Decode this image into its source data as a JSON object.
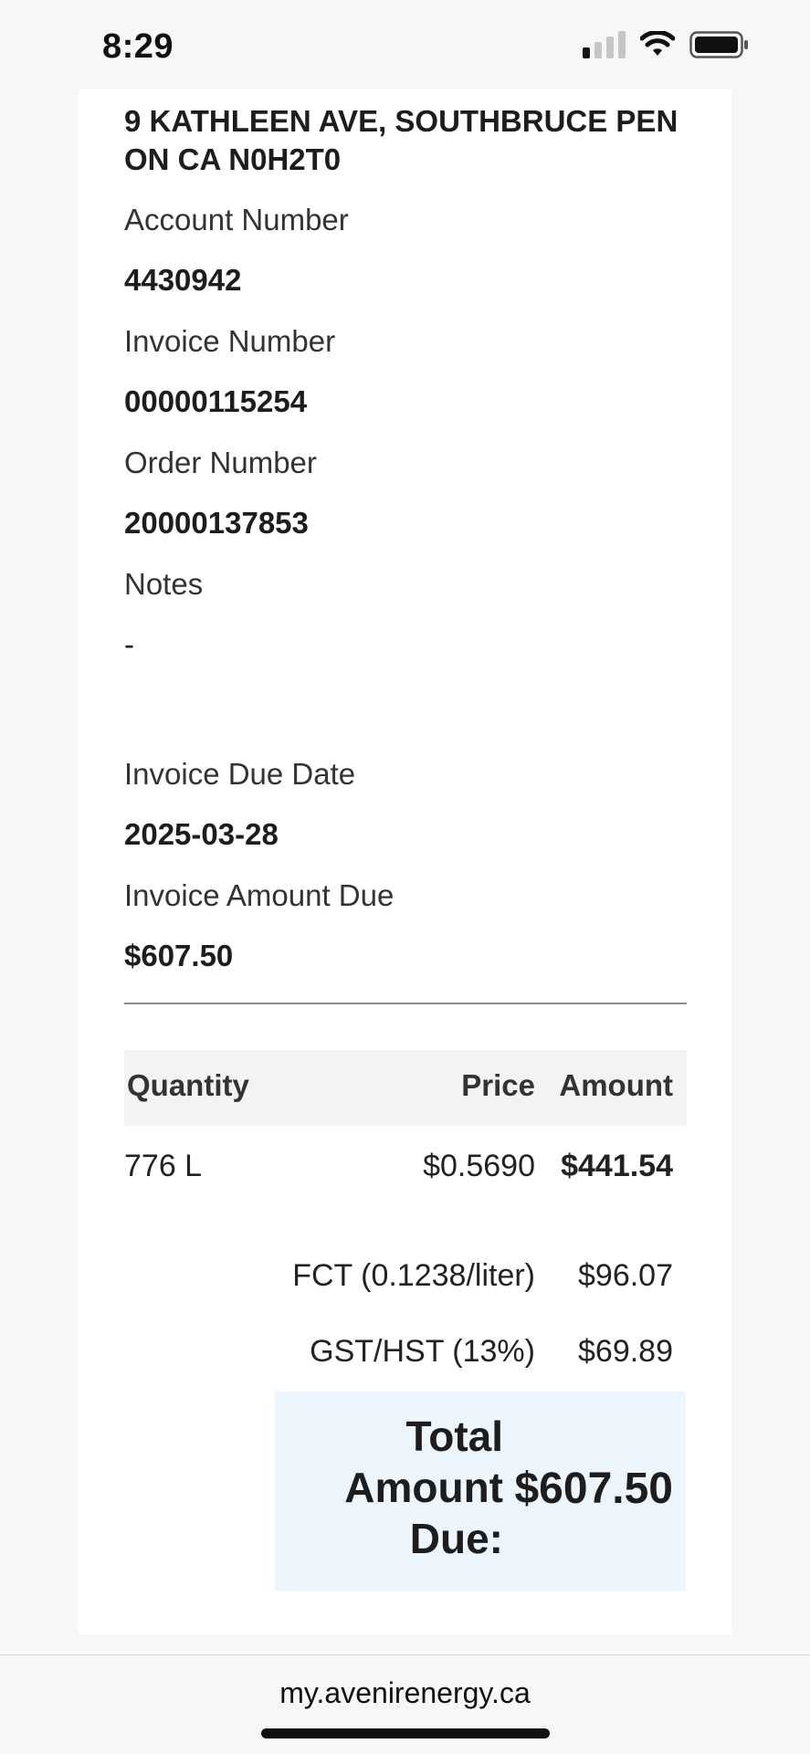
{
  "status_bar": {
    "time": "8:29",
    "icons": [
      "cellular-signal-icon",
      "wifi-icon",
      "battery-icon"
    ]
  },
  "invoice": {
    "address": "9 KATHLEEN AVE, SOUTHBRUCE PEN ON CA N0H2T0",
    "account_number_label": "Account Number",
    "account_number": "4430942",
    "invoice_number_label": "Invoice Number",
    "invoice_number": "00000115254",
    "order_number_label": "Order Number",
    "order_number": "20000137853",
    "notes_label": "Notes",
    "notes": "-",
    "due_date_label": "Invoice Due Date",
    "due_date": "2025-03-28",
    "amount_due_label": "Invoice Amount Due",
    "amount_due": "$607.50"
  },
  "table": {
    "headers": {
      "quantity": "Quantity",
      "price": "Price",
      "amount": "Amount"
    },
    "rows": [
      {
        "quantity": "776 L",
        "price": "$0.5690",
        "amount": "$441.54"
      }
    ]
  },
  "taxes": [
    {
      "label": "FCT (0.1238/liter)",
      "value": "$96.07"
    },
    {
      "label": "GST/HST (13%)",
      "value": "$69.89"
    }
  ],
  "total": {
    "label": "Total Amount Due:",
    "value": "$607.50"
  },
  "browser": {
    "url": "my.avenirenergy.ca"
  },
  "colors": {
    "total_box_bg": "#edf5fd",
    "header_bg": "#f3f3f3",
    "page_bg": "#f7f7f7"
  }
}
